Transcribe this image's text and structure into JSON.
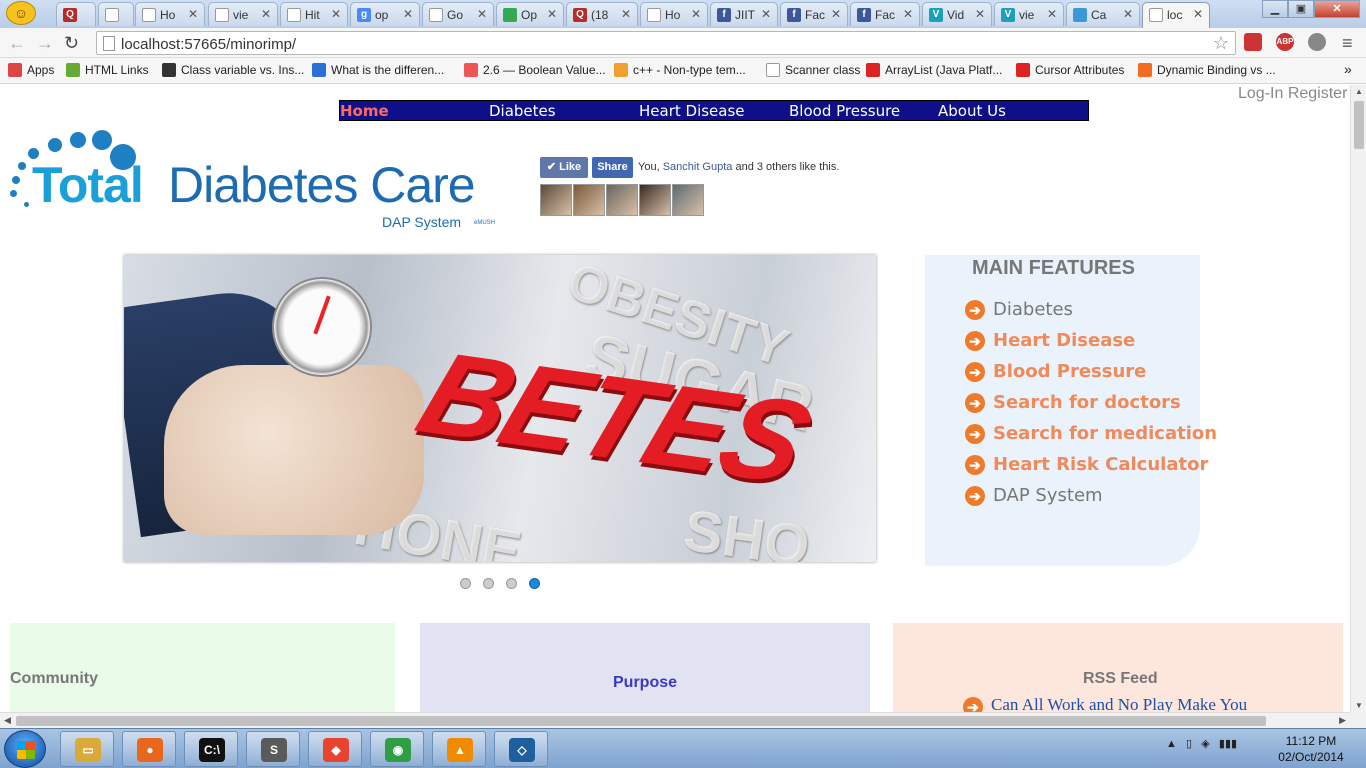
{
  "browser": {
    "tabs": [
      {
        "label": "",
        "fav": "Q",
        "color": "#b92b27"
      },
      {
        "label": "",
        "fav": "",
        "color": "#ffffff"
      },
      {
        "label": "Ho",
        "fav": "",
        "color": "#ffffff"
      },
      {
        "label": "vie",
        "fav": "",
        "color": "#ffffff"
      },
      {
        "label": "Hit",
        "fav": "",
        "color": "#ffffff"
      },
      {
        "label": "op",
        "fav": "g",
        "color": "#4a8af4"
      },
      {
        "label": "Go",
        "fav": "",
        "color": "#ffffff"
      },
      {
        "label": "Op",
        "fav": "",
        "color": "#34a853"
      },
      {
        "label": "(18",
        "fav": "Q",
        "color": "#b92b27"
      },
      {
        "label": "Ho",
        "fav": "",
        "color": "#ffffff"
      },
      {
        "label": "JIIT",
        "fav": "f",
        "color": "#3b5998"
      },
      {
        "label": "Fac",
        "fav": "f",
        "color": "#3b5998"
      },
      {
        "label": "Fac",
        "fav": "f",
        "color": "#3b5998"
      },
      {
        "label": "Vid",
        "fav": "V",
        "color": "#1aa0b8"
      },
      {
        "label": "vie",
        "fav": "V",
        "color": "#1aa0b8"
      },
      {
        "label": "Ca",
        "fav": "",
        "color": "#3a9ad9"
      },
      {
        "label": "loc",
        "fav": "",
        "color": "#ffffff",
        "active": true
      }
    ],
    "url": "localhost:57665/minorimp/",
    "bookmarks": [
      {
        "label": "Apps",
        "color": "#d44"
      },
      {
        "label": "HTML Links",
        "color": "#6a3"
      },
      {
        "label": "Class variable vs. Ins...",
        "color": "#333"
      },
      {
        "label": "What is the differen...",
        "color": "#2a6fd6"
      },
      {
        "label": "2.6 — Boolean Value...",
        "color": "#e55"
      },
      {
        "label": "c++ - Non-type tem...",
        "color": "#f0a030"
      },
      {
        "label": "Scanner class",
        "color": "#ffffff"
      },
      {
        "label": "ArrayList (Java Platf...",
        "color": "#d22"
      },
      {
        "label": "Cursor Attributes",
        "color": "#d22"
      },
      {
        "label": "Dynamic Binding vs ...",
        "color": "#f26d21"
      }
    ],
    "bookmarks_more": "»"
  },
  "site": {
    "nav": {
      "home": "Home",
      "diabetes": "Diabetes",
      "heart": "Heart Disease",
      "bp": "Blood Pressure",
      "about": "About Us"
    },
    "auth": "Log-In Register",
    "logo": {
      "total": "Total",
      "rest": "Diabetes Care",
      "sub": "DAP System",
      "tiny": "eMUSH"
    },
    "fb": {
      "like": "Like",
      "share": "Share",
      "text_before": "You, ",
      "name": "Sanchit Gupta",
      "text_after": " and 3 others like this.",
      "avatars": [
        "#5a4a3a",
        "#7a5a3a",
        "#6a6660",
        "#3a2a22",
        "#5f6b73"
      ]
    },
    "slider": {
      "headline": "BETES",
      "words": [
        "OBESITY",
        "SUGAR",
        "HONE",
        "SHO"
      ],
      "dots": 4,
      "active_dot": 4
    },
    "features": {
      "title": "MAIN FEATURES",
      "items": [
        {
          "label": "Diabetes",
          "style": "grey"
        },
        {
          "label": "Heart Disease",
          "style": "orange"
        },
        {
          "label": "Blood Pressure",
          "style": "orange"
        },
        {
          "label": "Search for doctors",
          "style": "orange"
        },
        {
          "label": "Search for medication",
          "style": "orange"
        },
        {
          "label": "Heart Risk Calculator",
          "style": "orange"
        },
        {
          "label": "DAP System",
          "style": "grey"
        }
      ]
    },
    "boxes": {
      "community": "Community",
      "purpose": "Purpose",
      "rss": "RSS Feed",
      "rss_item": "Can All Work and No Play Make You"
    }
  },
  "taskbar": {
    "apps": [
      {
        "name": "file-explorer-icon",
        "color": "#d9a93a",
        "glyph": "▭"
      },
      {
        "name": "firefox-icon",
        "color": "#e8671c",
        "glyph": "●"
      },
      {
        "name": "cmd-icon",
        "color": "#111111",
        "glyph": "C:\\"
      },
      {
        "name": "sublime-icon",
        "color": "#5a5a5a",
        "glyph": "S"
      },
      {
        "name": "git-icon",
        "color": "#e8432e",
        "glyph": "◆"
      },
      {
        "name": "chrome-icon",
        "color": "#2f9e44",
        "glyph": "◉"
      },
      {
        "name": "vlc-icon",
        "color": "#f08a00",
        "glyph": "▲"
      },
      {
        "name": "virtualbox-icon",
        "color": "#1f5fa0",
        "glyph": "◇"
      }
    ],
    "time": "11:12 PM",
    "date": "02/Oct/2014"
  },
  "colors": {
    "nav_bg": "#0f0f8a",
    "accent_orange": "#ef7a2a",
    "fb_blue": "#3b5998"
  }
}
